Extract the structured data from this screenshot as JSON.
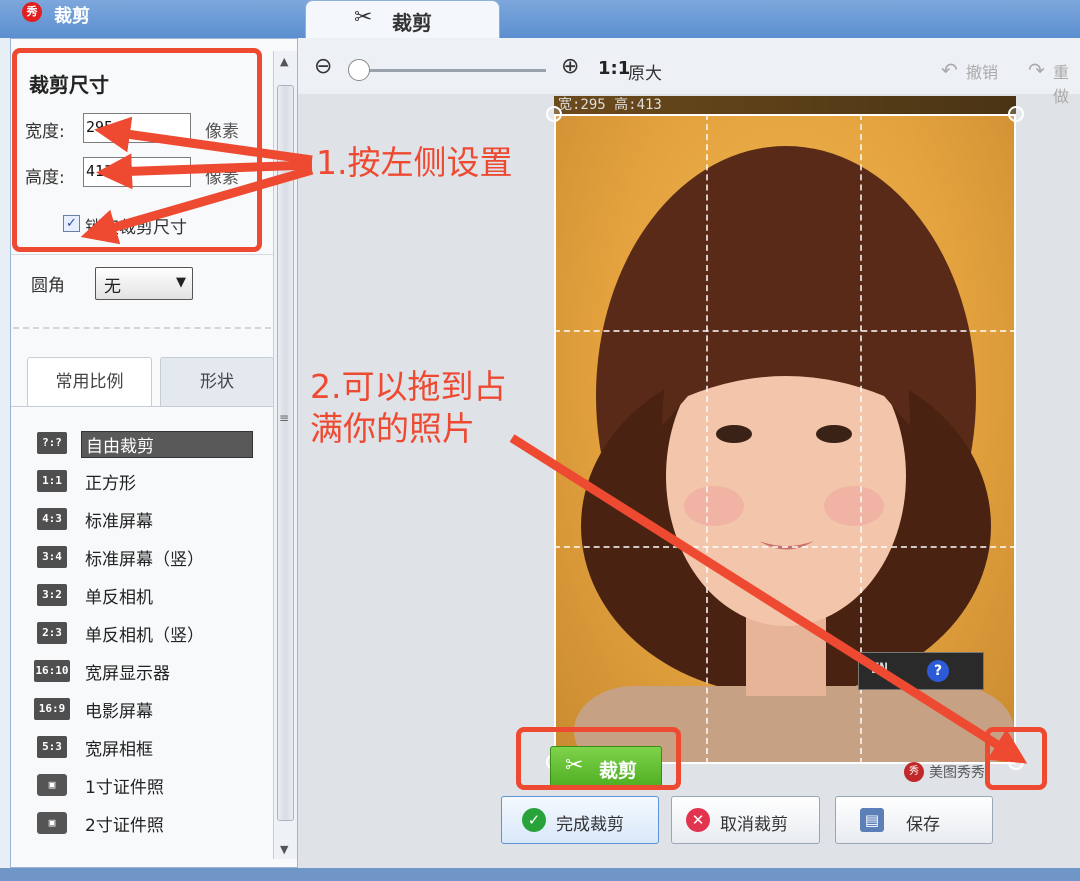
{
  "titlebar": {
    "app_logo": "秀",
    "title": "裁剪",
    "tab_label": "裁剪"
  },
  "left_panel": {
    "size_section_title": "裁剪尺寸",
    "width_label": "宽度:",
    "width_value": "295",
    "height_label": "高度:",
    "height_value": "413",
    "unit_label": "像素",
    "lock_checked": true,
    "lock_label": "锁定裁剪尺寸",
    "radius_label": "圆角",
    "radius_value": "无",
    "tabs": [
      {
        "label": "常用比例"
      },
      {
        "label": "形状"
      }
    ],
    "ratio_items": [
      {
        "badge": "?:?",
        "label": "自由裁剪"
      },
      {
        "badge": "1:1",
        "label": "正方形"
      },
      {
        "badge": "4:3",
        "label": "标准屏幕"
      },
      {
        "badge": "3:4",
        "label": "标准屏幕（竖）"
      },
      {
        "badge": "3:2",
        "label": "单反相机"
      },
      {
        "badge": "2:3",
        "label": "单反相机（竖）"
      },
      {
        "badge": "16:10",
        "label": "宽屏显示器"
      },
      {
        "badge": "16:9",
        "label": "电影屏幕"
      },
      {
        "badge": "5:3",
        "label": "宽屏相框"
      },
      {
        "badge": "ID",
        "label": "1寸证件照"
      },
      {
        "badge": "ID",
        "label": "2寸证件照"
      }
    ]
  },
  "toolbar": {
    "zoom_level": 0,
    "zoom_ratio": "1:1",
    "actual_size_label": "原大",
    "undo_label": "撤销",
    "redo_label": "重做"
  },
  "canvas": {
    "size_readout": "宽:295 高:413",
    "mini_panel_text": "EN",
    "help_symbol": "?",
    "watermark": "美图秀秀",
    "crop_button_label": "裁剪"
  },
  "actions": {
    "done_label": "完成裁剪",
    "cancel_label": "取消裁剪",
    "save_label": "保存"
  },
  "annotations": {
    "step1": "1.按左侧设置",
    "step2_line1": "2.可以拖到占",
    "step2_line2": "满你的照片",
    "color": "#ee4a32"
  },
  "colors": {
    "accent_blue": "#5c8fd0",
    "crop_green": "#4fae23",
    "annotation_red": "#ee4a32"
  }
}
